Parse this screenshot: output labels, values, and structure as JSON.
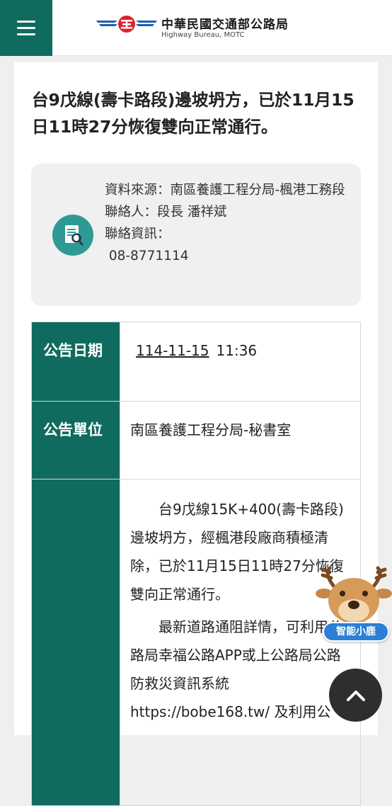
{
  "header": {
    "brand_title": "中華民國交通部公路局",
    "brand_subtitle": "Highway Bureau, MOTC"
  },
  "article": {
    "title": "台9戊線(壽卡路段)邊坡坍方，已於11月15日11時27分恢復雙向正常通行。"
  },
  "info": {
    "source": "資料來源：南區養護工程分局-楓港工務段",
    "contact_person": "聯絡人：段長 潘祥斌",
    "contact_label": "聯絡資訊：",
    "contact_phone": " 08-8771114"
  },
  "table": {
    "date_label": "公告日期",
    "date_value": "114-11-15",
    "time_value": "11:36",
    "unit_label": "公告單位",
    "unit_value": "南區養護工程分局-秘書室",
    "content_para1": "台9戊線15K+400(壽卡路段)邊坡坍方，經楓港段廠商積極清除，已於11月15日11時27分恢復雙向正常通行。",
    "content_para2": "最新道路通阻詳情，可利用公路局幸福公路APP或上公路局公路防救災資訊系統 https://bobe168.tw/ 及利用公"
  },
  "widgets": {
    "mascot_label": "智能小鹿"
  },
  "colors": {
    "brand_green": "#0f6b5e",
    "icon_teal": "#2f9a94",
    "mascot_blue": "#2b7fd4"
  },
  "icons": [
    "hamburger-menu-icon",
    "highway-bureau-logo",
    "document-search-icon",
    "deer-mascot-icon",
    "chevron-up-icon"
  ]
}
